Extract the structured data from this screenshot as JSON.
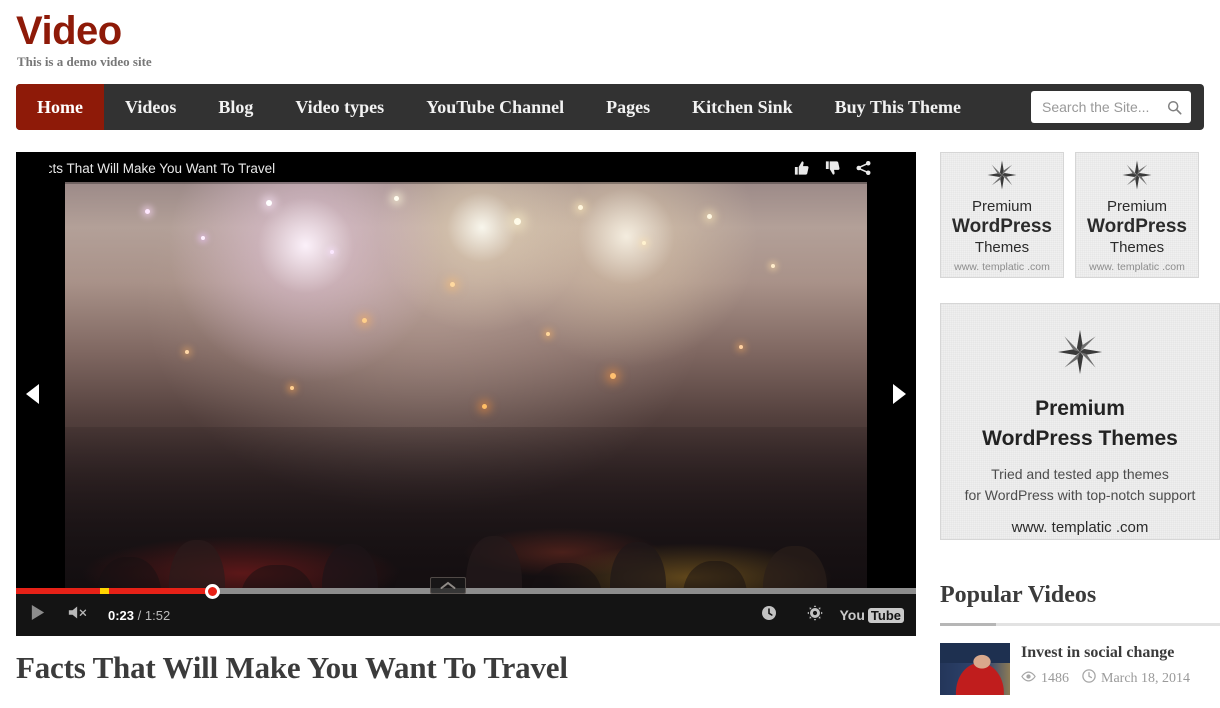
{
  "site": {
    "title": "Video",
    "tagline": "This is a demo video site"
  },
  "nav": {
    "items": [
      {
        "label": "Home",
        "active": true
      },
      {
        "label": "Videos",
        "active": false
      },
      {
        "label": "Blog",
        "active": false
      },
      {
        "label": "Video types",
        "active": false
      },
      {
        "label": "YouTube Channel",
        "active": false
      },
      {
        "label": "Pages",
        "active": false
      },
      {
        "label": "Kitchen Sink",
        "active": false
      },
      {
        "label": "Buy This Theme",
        "active": false
      }
    ],
    "search": {
      "placeholder": "Search the Site...",
      "value": "",
      "icon": "search-icon"
    }
  },
  "player": {
    "video_title": "Facts That Will Make You Want To Travel",
    "current_time": "0:23",
    "separator": " / ",
    "total_time": "1:52",
    "progress_percent": 23,
    "chapter_marker_percent": 10,
    "top_icons": [
      "thumbs-up-icon",
      "thumbs-down-icon",
      "share-icon",
      "info-icon"
    ],
    "bottom_left_icons": [
      "play-icon",
      "mute-icon"
    ],
    "bottom_right_icons": [
      "watch-later-icon",
      "settings-gear-icon"
    ],
    "youtube_logo": {
      "you": "You",
      "tube": "Tube"
    },
    "prev_arrow": "prev-slide-icon",
    "next_arrow": "next-slide-icon",
    "accent_color": "#e62117",
    "chapter_color": "#ffd400"
  },
  "post": {
    "title": "Facts That Will Make You Want To Travel"
  },
  "sidebar": {
    "ads_small": [
      {
        "line1": "Premium",
        "line2": "WordPress",
        "line3": "Themes",
        "url": "www. templatic .com",
        "logo": "starburst-icon"
      },
      {
        "line1": "Premium",
        "line2": "WordPress",
        "line3": "Themes",
        "url": "www. templatic .com",
        "logo": "starburst-icon"
      }
    ],
    "ad_big": {
      "logo": "starburst-icon",
      "heading_1": "Premium",
      "heading_2": "WordPress Themes",
      "desc_1": "Tried and tested app themes",
      "desc_2": "for WordPress with top-notch support",
      "url": "www. templatic .com"
    },
    "popular": {
      "title": "Popular Videos",
      "items": [
        {
          "title": "Invest in social change",
          "views": "1486",
          "date": "March 18, 2014",
          "views_icon": "eye-icon",
          "date_icon": "clock-icon",
          "thumb": "speaker-thumbnail"
        }
      ]
    }
  },
  "colors": {
    "brand_red": "#8e1a08",
    "nav_dark": "#323232",
    "text_dark": "#3b3b3b",
    "muted": "#9a9a9a"
  }
}
